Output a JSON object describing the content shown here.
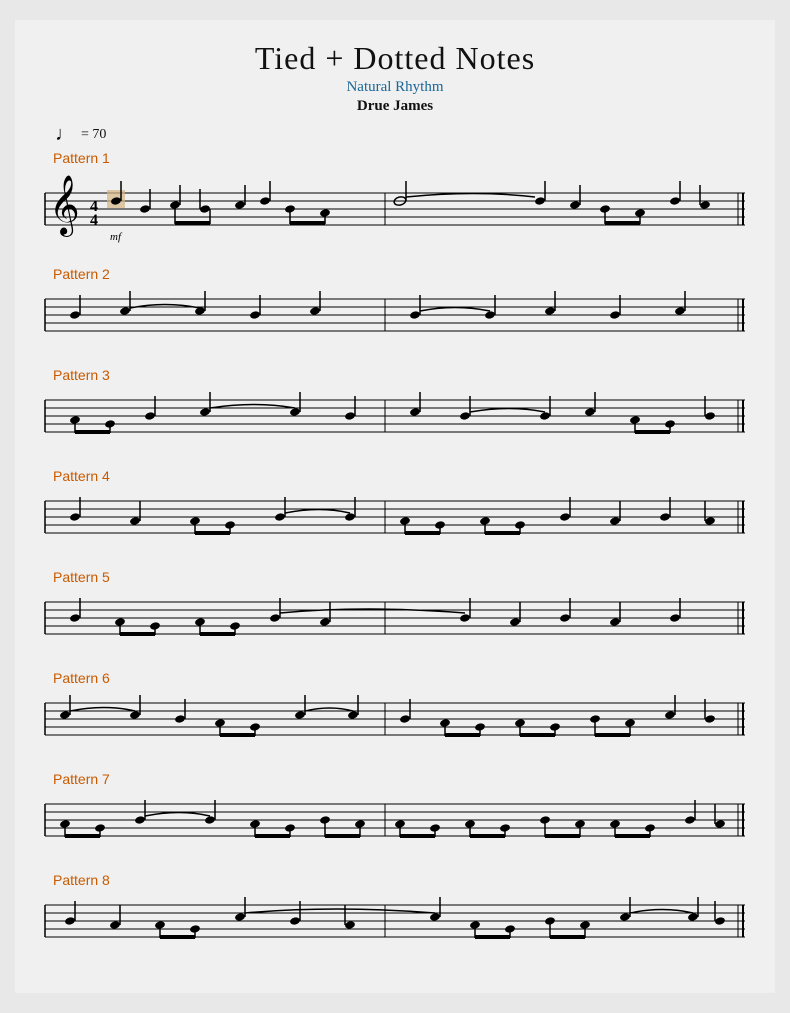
{
  "title": "Tied + Dotted Notes",
  "subtitle": "Natural Rhythm",
  "composer": "Drue James",
  "tempo": {
    "note": "♩",
    "value": "= 70"
  },
  "patterns": [
    {
      "label": "Pattern 1"
    },
    {
      "label": "Pattern 2"
    },
    {
      "label": "Pattern 3"
    },
    {
      "label": "Pattern 4"
    },
    {
      "label": "Pattern 5"
    },
    {
      "label": "Pattern 6"
    },
    {
      "label": "Pattern 7"
    },
    {
      "label": "Pattern 8"
    }
  ]
}
